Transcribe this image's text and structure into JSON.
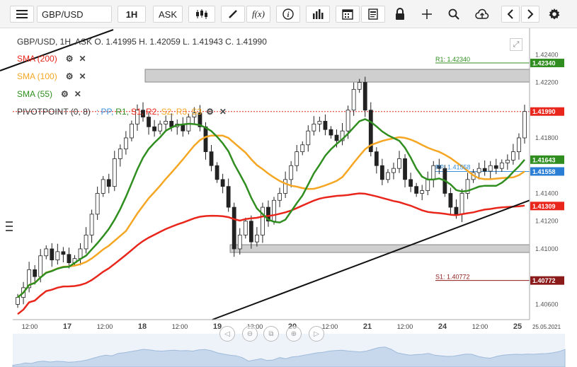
{
  "toolbar": {
    "symbol": "GBP/USD",
    "interval": "1H",
    "price_type": "ASK",
    "fx_label": "f(x)"
  },
  "header": {
    "ohlc": "GBP/USD, 1H, ASK   O. 1.41995 H. 1.42059 L. 1.41943 C. 1.41990"
  },
  "indicators": [
    {
      "label": "SMA (200)",
      "color": "#e8261b"
    },
    {
      "label": "SMA (100)",
      "color": "#f5a623"
    },
    {
      "label": "SMA (55)",
      "color": "#2f8e1f"
    }
  ],
  "pivot": {
    "label": "PIVOTPOINT (0, 8)",
    "parts": [
      {
        "text": ": PP,",
        "color": "#3a8fd8"
      },
      {
        "text": "R1,",
        "color": "#2f8e1f"
      },
      {
        "text": "S1,",
        "color": "#e8261b"
      },
      {
        "text": "R2,",
        "color": "#e8261b"
      },
      {
        "text": "S2,",
        "color": "#f5a623"
      },
      {
        "text": "R3,",
        "color": "#f5a623"
      },
      {
        "text": "S3",
        "color": "#f5a623"
      }
    ]
  },
  "price_axis": {
    "ticks": [
      "1.42400",
      "1.42200",
      "1.41800",
      "1.41400",
      "1.41200",
      "1.41000",
      "1.40600"
    ],
    "tags": [
      {
        "value": "1.42340",
        "color": "#2f8e1f"
      },
      {
        "value": "1.41990",
        "color": "#e8261b"
      },
      {
        "value": "1.41643",
        "color": "#2f8e1f"
      },
      {
        "value": "1.41558",
        "color": "#2a7fd4"
      },
      {
        "value": "1.41309",
        "color": "#e8261b"
      },
      {
        "value": "1.40772",
        "color": "#8b1a1a"
      }
    ]
  },
  "pivot_labels": {
    "r1": "R1: 1.42340",
    "s1": "S1: 1.40772",
    "pp": "PP: 1.41558"
  },
  "time_axis": {
    "labels": [
      "12:00",
      "17",
      "12:00",
      "18",
      "12:00",
      "19",
      "12:00",
      "20",
      "12:00",
      "21",
      "12:00",
      "24",
      "12:00",
      "25"
    ],
    "date_label": "25.05.2021"
  },
  "chart_data": {
    "type": "candlestick",
    "title": "GBP/USD, 1H, ASK",
    "symbol": "GBP/USD",
    "ohlc_last": {
      "open": 1.41995,
      "high": 1.42059,
      "low": 1.41943,
      "close": 1.4199
    },
    "ylim": [
      1.4049,
      1.4259
    ],
    "series": [
      {
        "name": "SMA (200)",
        "color": "#e8261b",
        "last": 1.41309
      },
      {
        "name": "SMA (100)",
        "color": "#f5a623",
        "last": 1.41558
      },
      {
        "name": "SMA (55)",
        "color": "#2f8e1f",
        "last": 1.41643
      }
    ],
    "pivots": {
      "R1": 1.4234,
      "PP": 1.41558,
      "S1": 1.40772
    },
    "closes": [
      1.4065,
      1.4072,
      1.4085,
      1.408,
      1.4095,
      1.41,
      1.4092,
      1.4098,
      1.4096,
      1.409,
      1.4093,
      1.41,
      1.411,
      1.4125,
      1.414,
      1.415,
      1.4145,
      1.4165,
      1.4172,
      1.418,
      1.419,
      1.42,
      1.4195,
      1.4188,
      1.4185,
      1.419,
      1.4192,
      1.4188,
      1.419,
      1.4185,
      1.4195,
      1.4198,
      1.4188,
      1.417,
      1.416,
      1.415,
      1.4145,
      1.413,
      1.41,
      1.411,
      1.412,
      1.4105,
      1.411,
      1.413,
      1.412,
      1.4135,
      1.414,
      1.415,
      1.416,
      1.417,
      1.4175,
      1.4185,
      1.419,
      1.4192,
      1.4186,
      1.4182,
      1.4178,
      1.4185,
      1.42,
      1.4215,
      1.422,
      1.42,
      1.417,
      1.416,
      1.415,
      1.4155,
      1.4158,
      1.4165,
      1.415,
      1.4145,
      1.414,
      1.4142,
      1.415,
      1.416,
      1.4158,
      1.414,
      1.413,
      1.4125,
      1.414,
      1.415,
      1.4155,
      1.4158,
      1.4156,
      1.416,
      1.4158,
      1.4162,
      1.4164,
      1.417,
      1.418,
      1.4199
    ]
  }
}
